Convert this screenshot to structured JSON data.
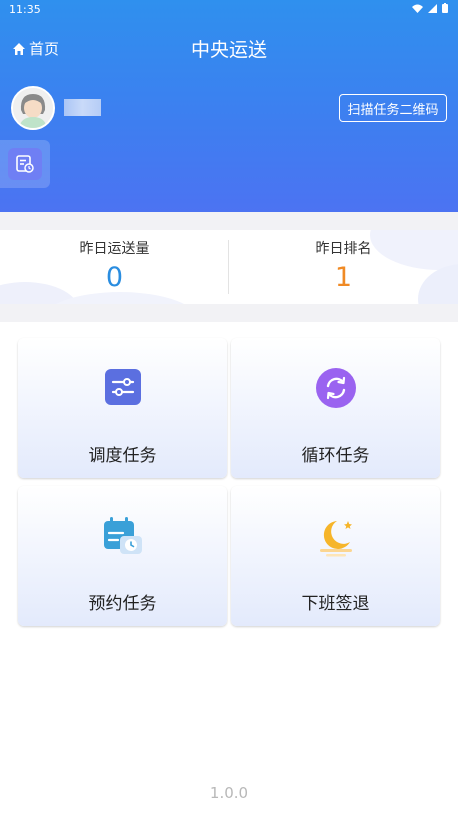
{
  "status_bar": {
    "time": "11:35"
  },
  "nav": {
    "home_label": "首页",
    "title": "中央运送"
  },
  "user": {
    "scan_button_label": "扫描任务二维码"
  },
  "stats": {
    "left": {
      "label": "昨日运送量",
      "value": "0",
      "color": "#2a8de0"
    },
    "right": {
      "label": "昨日排名",
      "value": "1",
      "color": "#f08a24"
    }
  },
  "menu": [
    {
      "label": "调度任务",
      "icon": "sliders-icon",
      "color": "#5b6fe0"
    },
    {
      "label": "循环任务",
      "icon": "cycle-icon",
      "color": "#9a63f0"
    },
    {
      "label": "预约任务",
      "icon": "calendar-clock-icon",
      "color": "#3aa0d8"
    },
    {
      "label": "下班签退",
      "icon": "moon-icon",
      "color": "#f6b52a"
    }
  ],
  "footer": {
    "version": "1.0.0"
  }
}
